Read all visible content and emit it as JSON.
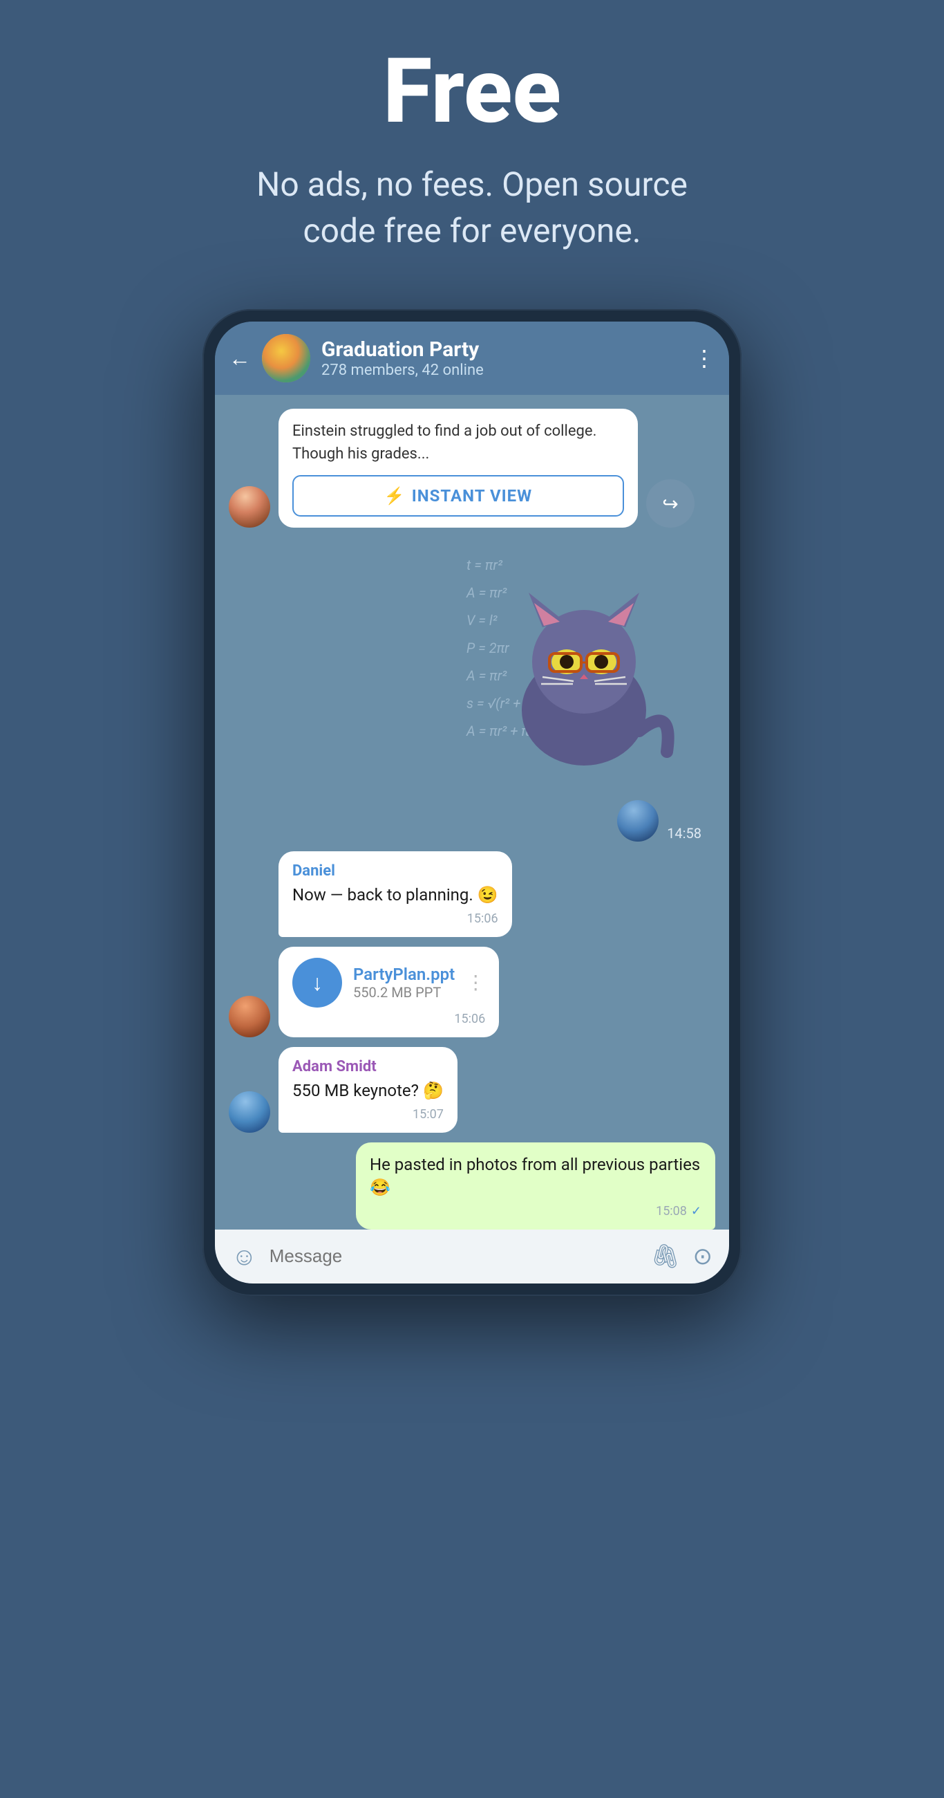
{
  "hero": {
    "title": "Free",
    "subtitle": "No ads, no fees. Open source code free for everyone."
  },
  "chat": {
    "back_label": "←",
    "group_name": "Graduation Party",
    "group_status": "278 members, 42 online",
    "menu_icon": "⋮",
    "messages": [
      {
        "id": "article-msg",
        "type": "article",
        "article_text": "Einstein struggled to find a job out of college. Though his grades...",
        "instant_view_label": "INSTANT VIEW",
        "instant_view_icon": "⚡"
      },
      {
        "id": "sticker-msg",
        "type": "sticker",
        "time": "14:58"
      },
      {
        "id": "daniel-msg",
        "type": "text",
        "sender": "Daniel",
        "text": "Now — back to planning. 😉",
        "time": "15:06"
      },
      {
        "id": "file-msg",
        "type": "file",
        "file_name": "PartyPlan.ppt",
        "file_size": "550.2 MB PPT",
        "time": "15:06"
      },
      {
        "id": "adam-msg",
        "type": "text",
        "sender": "Adam Smidt",
        "text": "550 MB keynote? 🤔",
        "time": "15:07"
      },
      {
        "id": "own-msg",
        "type": "own",
        "text": "He pasted in photos from all previous parties 😂",
        "time": "15:08"
      }
    ],
    "input_placeholder": "Message"
  }
}
